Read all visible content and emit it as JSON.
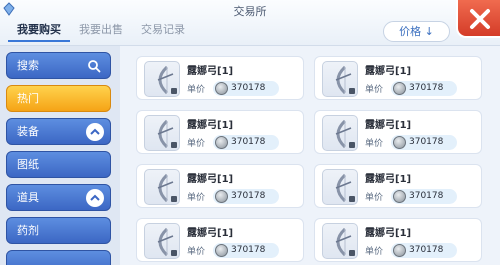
{
  "header": {
    "title": "交易所",
    "tabs": [
      {
        "label": "我要购买",
        "active": true
      },
      {
        "label": "我要出售",
        "active": false
      },
      {
        "label": "交易记录",
        "active": false
      }
    ],
    "sort_label": "价格 ↓"
  },
  "sidebar": {
    "items": [
      {
        "label": "搜索",
        "icon": "search-icon"
      },
      {
        "label": "热门",
        "selected": true
      },
      {
        "label": "装备",
        "icon": "chevron-up-icon"
      },
      {
        "label": "图纸"
      },
      {
        "label": "道具",
        "icon": "chevron-up-icon"
      },
      {
        "label": "药剂"
      }
    ]
  },
  "listings": [
    {
      "name": "露娜弓[1]",
      "price_label": "单价",
      "price": "370178"
    },
    {
      "name": "露娜弓[1]",
      "price_label": "单价",
      "price": "370178"
    },
    {
      "name": "露娜弓[1]",
      "price_label": "单价",
      "price": "370178"
    },
    {
      "name": "露娜弓[1]",
      "price_label": "单价",
      "price": "370178"
    },
    {
      "name": "露娜弓[1]",
      "price_label": "单价",
      "price": "370178"
    },
    {
      "name": "露娜弓[1]",
      "price_label": "单价",
      "price": "370178"
    },
    {
      "name": "露娜弓[1]",
      "price_label": "单价",
      "price": "370178"
    },
    {
      "name": "露娜弓[1]",
      "price_label": "单价",
      "price": "370178"
    }
  ],
  "colors": {
    "accent": "#3c67c4",
    "hot": "#f5a316",
    "close": "#d43c28"
  }
}
